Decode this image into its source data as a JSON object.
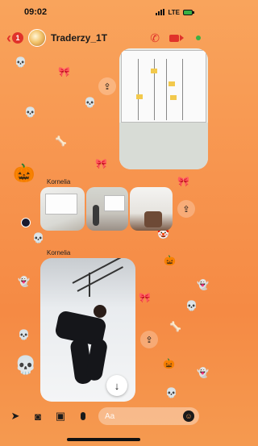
{
  "status_bar": {
    "time": "09:02",
    "network": "LTE"
  },
  "header": {
    "back_count": "1",
    "title": "Traderzy_1T"
  },
  "messages": [
    {
      "type": "photo",
      "description_icon": "share-icon"
    },
    {
      "type": "photo-group",
      "sender": "Kornelia"
    },
    {
      "type": "photo",
      "sender": "Kornelia"
    }
  ],
  "composer": {
    "placeholder": "Aa"
  },
  "colors": {
    "accent": "#e0322a",
    "background": "#f7944e",
    "online": "#3cb043"
  },
  "icons": {
    "back": "chevron-left-icon",
    "call": "phone-icon",
    "video": "video-camera-icon",
    "share": "share-icon",
    "download": "arrow-down-icon",
    "location": "location-arrow-icon",
    "camera": "camera-icon",
    "gallery": "image-icon",
    "mic": "microphone-icon",
    "emoji": "smiley-icon"
  }
}
